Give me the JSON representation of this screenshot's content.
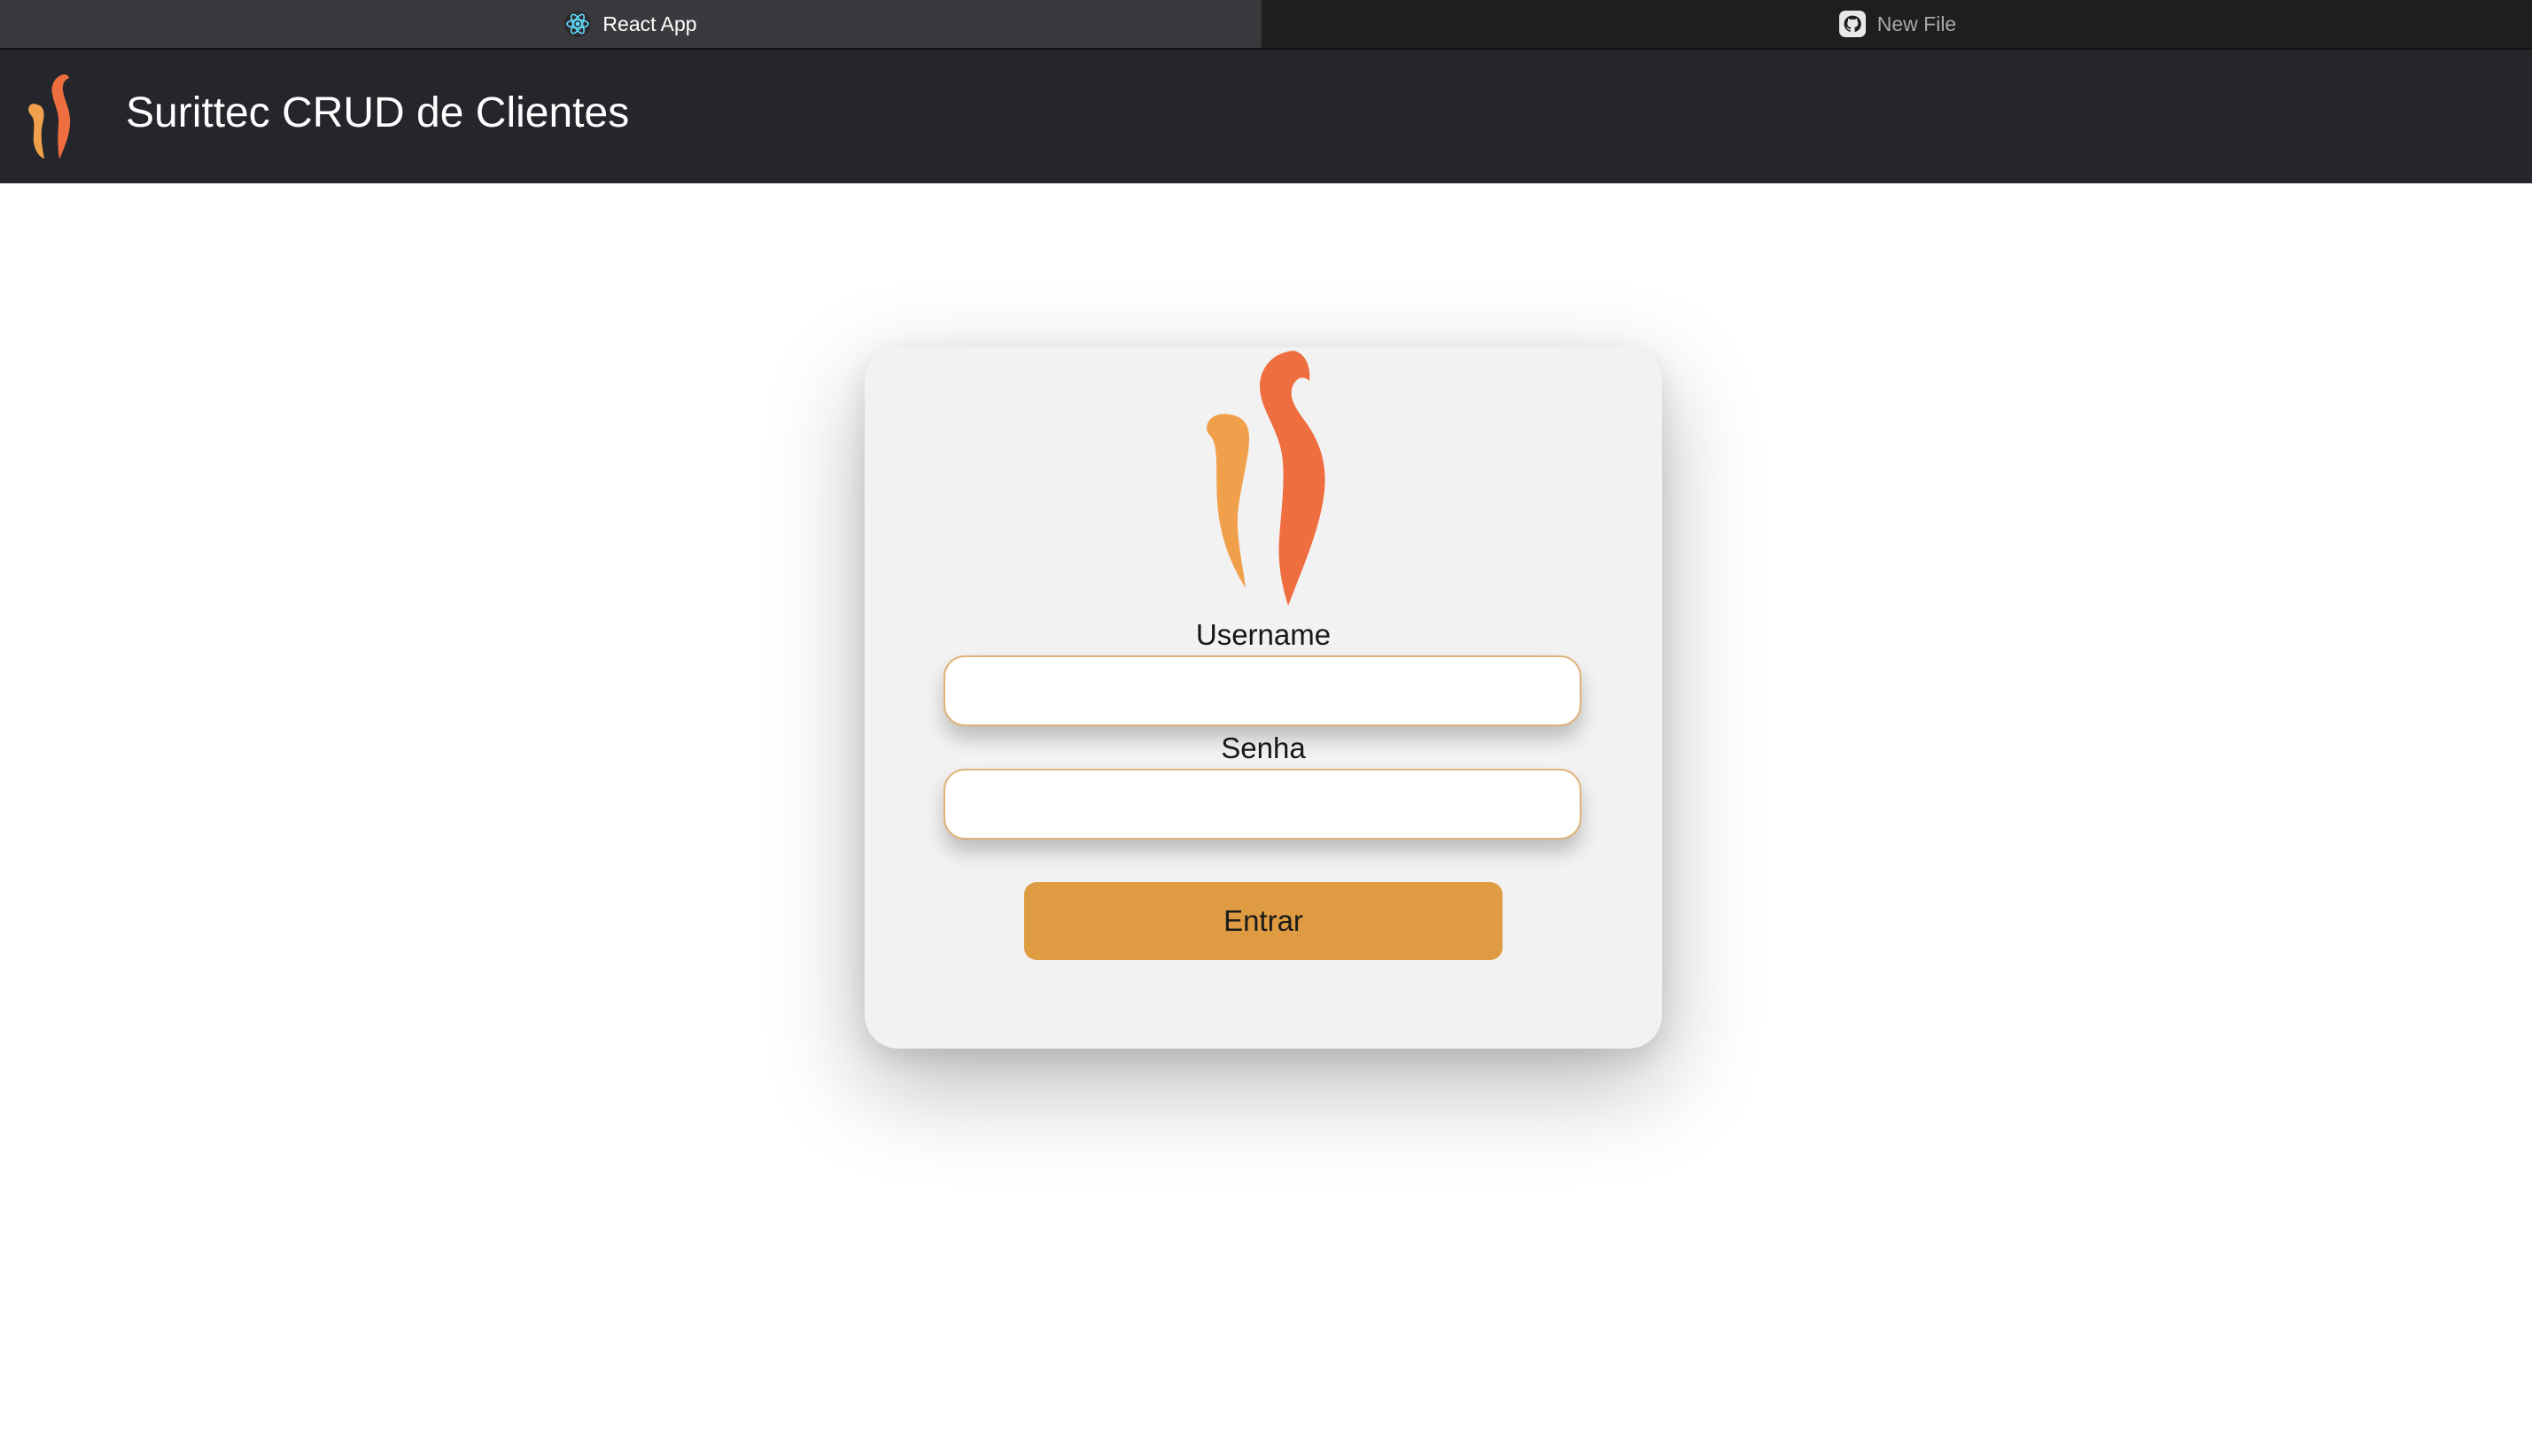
{
  "browser": {
    "tabs": [
      {
        "label": "React App",
        "icon": "react-icon",
        "active": true
      },
      {
        "label": "New File",
        "icon": "github-icon",
        "active": false
      }
    ]
  },
  "header": {
    "logo": "flame-logo",
    "title": "Surittec CRUD de Clientes"
  },
  "login": {
    "logo": "flame-logo",
    "username_label": "Username",
    "username_value": "",
    "password_label": "Senha",
    "password_value": "",
    "submit_label": "Entrar"
  },
  "colors": {
    "header_background": "#24262b",
    "card_background": "#f3f2f2",
    "button_background": "#df9b41",
    "input_border": "#e0b27a",
    "logo_light": "#f0a04b",
    "logo_dark": "#ee6e40"
  }
}
